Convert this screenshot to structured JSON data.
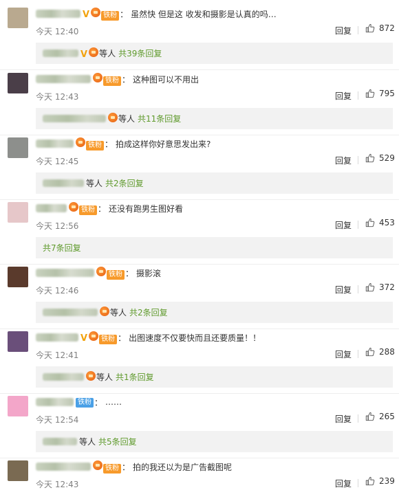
{
  "labels": {
    "reply": "回复",
    "deng": "等人",
    "colon": "："
  },
  "comments": [
    {
      "name_badges": [
        "v",
        "level",
        "fan"
      ],
      "fan_label": "铁粉",
      "text": "虽然快 但是这 收发和摄影是认真的吗…",
      "time": "今天 12:40",
      "likes": "872",
      "sub_badges": [
        "v",
        "level"
      ],
      "sub_count": "共39条回复",
      "avatar": "#b9a98f"
    },
    {
      "name_badges": [
        "level",
        "fan"
      ],
      "fan_label": "铁粉",
      "text": "这种图可以不用出",
      "time": "今天 12:43",
      "likes": "795",
      "sub_badges": [
        "level"
      ],
      "sub_count": "共11条回复",
      "avatar": "#4a3e48"
    },
    {
      "name_badges": [
        "level",
        "fan"
      ],
      "fan_label": "铁粉",
      "text": "拍成这样你好意思发出来?",
      "time": "今天 12:45",
      "likes": "529",
      "sub_badges": [],
      "sub_count": "共2条回复",
      "avatar": "#8d8f8c"
    },
    {
      "name_badges": [
        "level",
        "fan"
      ],
      "fan_label": "铁粉",
      "text": "还没有跑男生图好看",
      "time": "今天 12:56",
      "likes": "453",
      "sub_badges": null,
      "sub_count": "共7条回复",
      "avatar": "#e6c7c9"
    },
    {
      "name_badges": [
        "level",
        "fan"
      ],
      "fan_label": "铁粉",
      "text": "摄影滚",
      "time": "今天 12:46",
      "likes": "372",
      "sub_badges": [
        "level"
      ],
      "sub_count": "共2条回复",
      "avatar": "#5a3a2c"
    },
    {
      "name_badges": [
        "v",
        "level",
        "fan"
      ],
      "fan_label": "铁粉",
      "text": "出图速度不仅要快而且还要质量！！",
      "time": "今天 12:41",
      "likes": "288",
      "sub_badges": [
        "level"
      ],
      "sub_count": "共1条回复",
      "avatar": "#6a4f7a"
    },
    {
      "name_badges": [
        "fanblue"
      ],
      "fan_label": "铁粉",
      "text": "……",
      "time": "今天 12:54",
      "likes": "265",
      "sub_badges": [],
      "sub_count": "共5条回复",
      "avatar": "#f3a6c9"
    },
    {
      "name_badges": [
        "level",
        "fan"
      ],
      "fan_label": "铁粉",
      "text": "拍的我还以为是广告截图呢",
      "time": "今天 12:43",
      "likes": "239",
      "sub_badges": null,
      "sub_count": "",
      "avatar": "#7a6a52"
    }
  ]
}
